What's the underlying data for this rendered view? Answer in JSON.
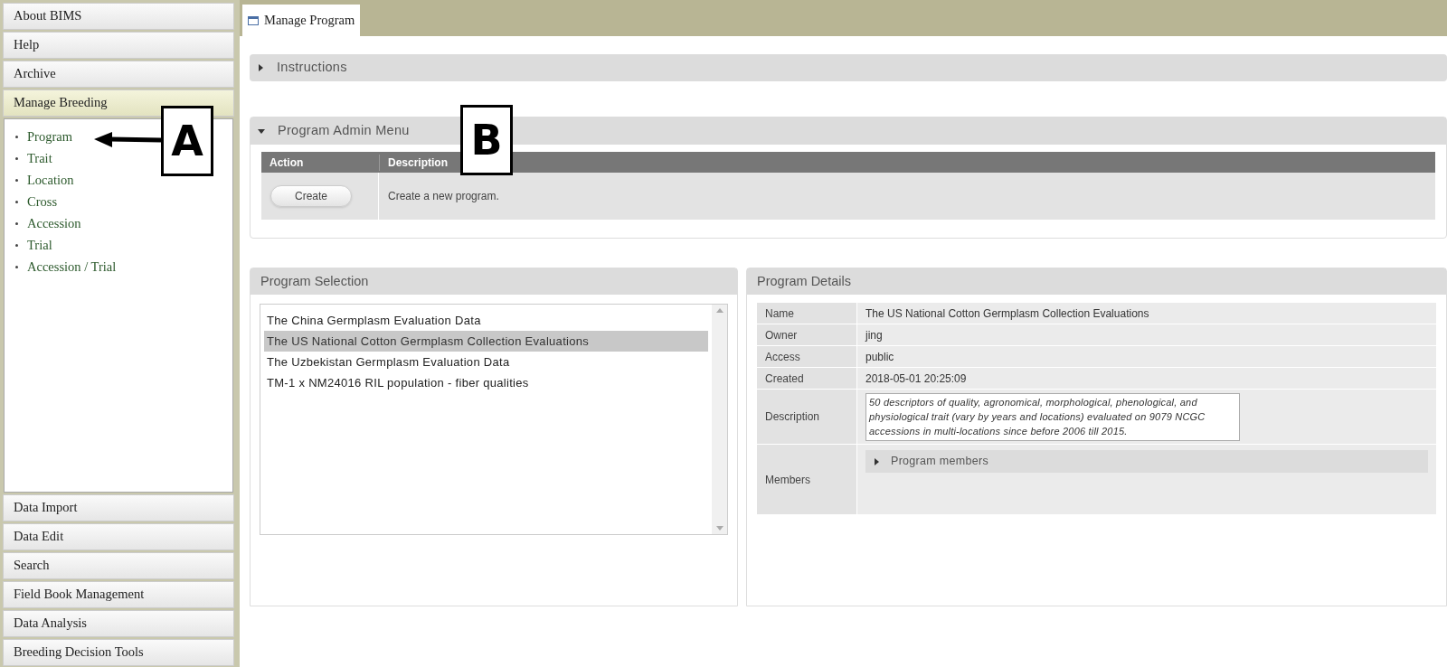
{
  "sidebar": {
    "sections": [
      {
        "label": "About BIMS",
        "expanded": false
      },
      {
        "label": "Help",
        "expanded": false
      },
      {
        "label": "Archive",
        "expanded": false
      },
      {
        "label": "Manage Breeding",
        "expanded": true,
        "items": [
          "Program",
          "Trait",
          "Location",
          "Cross",
          "Accession",
          "Trial",
          "Accession / Trial"
        ]
      },
      {
        "label": "Data Import",
        "expanded": false
      },
      {
        "label": "Data Edit",
        "expanded": false
      },
      {
        "label": "Search",
        "expanded": false
      },
      {
        "label": "Field Book Management",
        "expanded": false
      },
      {
        "label": "Data Analysis",
        "expanded": false
      },
      {
        "label": "Breeding Decision Tools",
        "expanded": false
      }
    ]
  },
  "tab": {
    "label": "Manage Program",
    "selected": true
  },
  "instructions": {
    "label": "Instructions",
    "expanded": false
  },
  "admin_menu": {
    "title": "Program Admin Menu",
    "expanded": true,
    "columns": [
      "Action",
      "Description"
    ],
    "rows": [
      {
        "action": "Create",
        "description": "Create a new program."
      }
    ]
  },
  "program_selection": {
    "title": "Program Selection",
    "options": [
      {
        "label": "The China Germplasm Evaluation Data",
        "selected": false
      },
      {
        "label": "The US National Cotton Germplasm Collection Evaluations",
        "selected": true
      },
      {
        "label": "The Uzbekistan Germplasm Evaluation Data",
        "selected": false
      },
      {
        "label": "TM-1 x NM24016 RIL population - fiber qualities",
        "selected": false
      }
    ]
  },
  "program_details": {
    "title": "Program Details",
    "rows": [
      {
        "kind": "text",
        "label": "Name",
        "value": "The US National Cotton Germplasm Collection Evaluations"
      },
      {
        "kind": "text",
        "label": "Owner",
        "value": "jing"
      },
      {
        "kind": "text",
        "label": "Access",
        "value": "public"
      },
      {
        "kind": "text",
        "label": "Created",
        "value": "2018-05-01 20:25:09"
      },
      {
        "kind": "textarea",
        "label": "Description",
        "value": "50 descriptors of quality, agronomical, morphological, phenological, and physiological trait (vary by years and locations) evaluated on 9079 NCGC accessions in multi-locations since before 2006 till 2015."
      },
      {
        "kind": "collapsible",
        "label": "Members",
        "value": "Program members",
        "expanded": false
      }
    ]
  },
  "callouts": [
    {
      "label": "A",
      "arrow": true
    },
    {
      "label": "B",
      "arrow": false
    }
  ]
}
